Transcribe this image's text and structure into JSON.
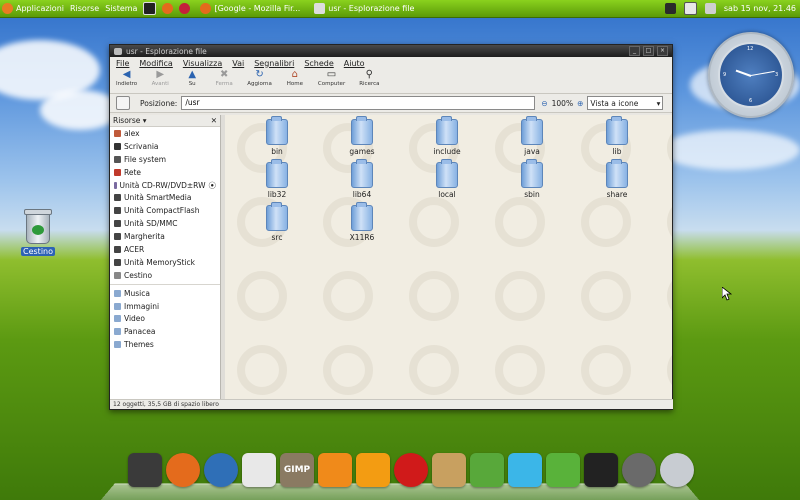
{
  "top_panel": {
    "menus": [
      "Applicazioni",
      "Risorse",
      "Sistema"
    ],
    "tasks": [
      {
        "label": "[Google - Mozilla Fir...",
        "icon": "firefox-icon"
      },
      {
        "label": "usr - Esplorazione file",
        "icon": "folder-icon"
      }
    ],
    "datetime": "sab 15 nov, 21.46"
  },
  "desktop": {
    "trash_label": "Cestino"
  },
  "window": {
    "title": "usr - Esplorazione file",
    "menu": [
      "File",
      "Modifica",
      "Visualizza",
      "Vai",
      "Segnalibri",
      "Schede",
      "Aiuto"
    ],
    "toolbar": [
      {
        "label": "Indietro",
        "icon": "back-arrow-icon",
        "disabled": false
      },
      {
        "label": "Avanti",
        "icon": "forward-arrow-icon",
        "disabled": true
      },
      {
        "label": "Su",
        "icon": "up-arrow-icon",
        "disabled": false
      },
      {
        "label": "Ferma",
        "icon": "stop-icon",
        "disabled": true
      },
      {
        "label": "Aggiorna",
        "icon": "reload-icon",
        "disabled": false
      },
      {
        "label": "Home",
        "icon": "home-icon",
        "disabled": false
      },
      {
        "label": "Computer",
        "icon": "computer-icon",
        "disabled": false
      },
      {
        "label": "Ricerca",
        "icon": "search-icon",
        "disabled": false
      }
    ],
    "location": {
      "label": "Posizione:",
      "value": "/usr",
      "zoom": "100%",
      "view_mode": "Vista a icone"
    },
    "sidebar": {
      "header": "Risorse",
      "places": [
        {
          "label": "alex",
          "icon": "home-folder-icon",
          "color": "#c05a3a"
        },
        {
          "label": "Scrivania",
          "icon": "desktop-icon",
          "color": "#333333"
        },
        {
          "label": "File system",
          "icon": "harddisk-icon",
          "color": "#555555"
        },
        {
          "label": "Rete",
          "icon": "network-icon",
          "color": "#c0392b"
        },
        {
          "label": "Unità CD-RW/DVD±RW",
          "icon": "optical-drive-icon",
          "color": "#7a6aa0"
        },
        {
          "label": "Unità SmartMedia",
          "icon": "drive-icon",
          "color": "#444444"
        },
        {
          "label": "Unità CompactFlash",
          "icon": "drive-icon",
          "color": "#444444"
        },
        {
          "label": "Unità SD/MMC",
          "icon": "drive-icon",
          "color": "#444444"
        },
        {
          "label": "Margherita",
          "icon": "drive-icon",
          "color": "#444444"
        },
        {
          "label": "ACER",
          "icon": "drive-icon",
          "color": "#444444"
        },
        {
          "label": "Unità MemoryStick",
          "icon": "drive-icon",
          "color": "#444444"
        },
        {
          "label": "Cestino",
          "icon": "trash-icon",
          "color": "#888888"
        }
      ],
      "bookmarks": [
        {
          "label": "Musica",
          "icon": "folder-icon"
        },
        {
          "label": "Immagini",
          "icon": "folder-icon"
        },
        {
          "label": "Video",
          "icon": "folder-icon"
        },
        {
          "label": "Panacea",
          "icon": "folder-icon"
        },
        {
          "label": "Themes",
          "icon": "folder-icon"
        }
      ]
    },
    "files": [
      "bin",
      "games",
      "include",
      "java",
      "lib",
      "lib32",
      "lib64",
      "local",
      "sbin",
      "share",
      "src",
      "X11R6"
    ],
    "status": "12 oggetti, 35,5 GB di spazio libero"
  },
  "dock": [
    {
      "icon": "system-monitor-icon",
      "color": "#3a3a3a"
    },
    {
      "icon": "firefox-icon",
      "color": "#e46b1c"
    },
    {
      "icon": "thunderbird-icon",
      "color": "#2f6fb7"
    },
    {
      "icon": "mail-envelope-icon",
      "color": "#e8e8e8"
    },
    {
      "icon": "gimp-icon",
      "color": "#8a7a62",
      "label": "GIMP"
    },
    {
      "icon": "vlc-icon",
      "color": "#f08a1a"
    },
    {
      "icon": "vlc-cone-icon",
      "color": "#f39c12"
    },
    {
      "icon": "media-player-icon",
      "color": "#d01a1a"
    },
    {
      "icon": "archive-icon",
      "color": "#c8a060"
    },
    {
      "icon": "office-icon",
      "color": "#58a83a"
    },
    {
      "icon": "writer-icon",
      "color": "#3bb6e8"
    },
    {
      "icon": "calc-icon",
      "color": "#59b23a"
    },
    {
      "icon": "terminal-icon",
      "color": "#222222"
    },
    {
      "icon": "network-globe-icon",
      "color": "#6a6a6a"
    },
    {
      "icon": "weather-icon",
      "color": "#c8ccd2"
    }
  ]
}
